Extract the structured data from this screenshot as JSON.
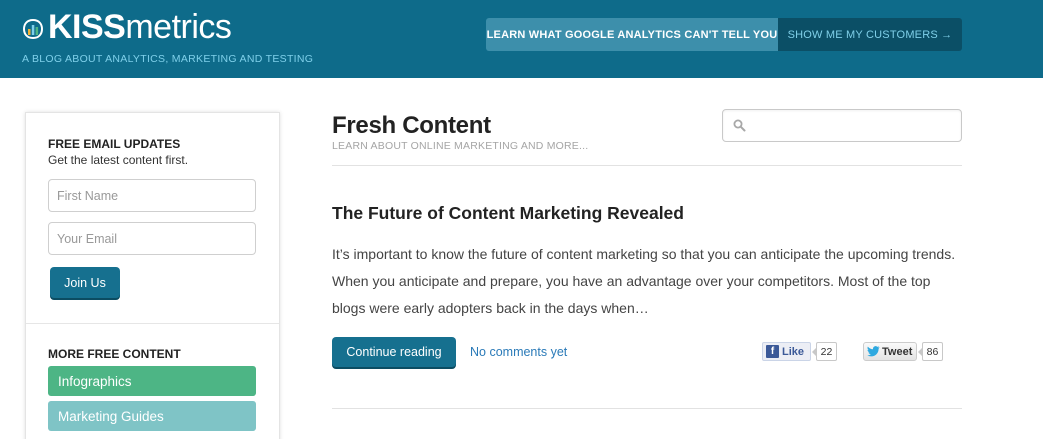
{
  "header": {
    "logo_bold": "KISS",
    "logo_light": "metrics",
    "tagline": "A BLOG ABOUT ANALYTICS, MARKETING AND TESTING",
    "cta_primary": "LEARN WHAT GOOGLE ANALYTICS CAN'T TELL YOU",
    "cta_secondary": "SHOW ME MY CUSTOMERS →",
    "colors": {
      "bar": "#0e6b8a",
      "cta_primary_bg": "#3d8fab",
      "cta_secondary_bg": "#0b4f66"
    }
  },
  "sidebar": {
    "email_title": "FREE EMAIL UPDATES",
    "email_subtitle": "Get the latest content first.",
    "first_name_placeholder": "First Name",
    "email_placeholder": "Your Email",
    "join_label": "Join Us",
    "more_title": "MORE FREE CONTENT",
    "links": [
      {
        "label": "Infographics",
        "color": "#4db585"
      },
      {
        "label": "Marketing Guides",
        "color": "#7fc4c6"
      }
    ]
  },
  "main": {
    "title": "Fresh Content",
    "subtitle": "LEARN ABOUT ONLINE MARKETING AND MORE...",
    "search": {
      "icon": "search-icon",
      "value": ""
    },
    "post": {
      "title": "The Future of Content Marketing Revealed",
      "excerpt": "It’s important to know the future of content marketing so that you can anticipate the upcoming trends. When you anticipate and prepare, you have an advantage over your competitors. Most of the top blogs were early adopters back in the days when…",
      "continue_label": "Continue reading",
      "comments_label": "No comments yet",
      "like_label": "Like",
      "like_count": "22",
      "tweet_label": "Tweet",
      "tweet_count": "86"
    }
  }
}
